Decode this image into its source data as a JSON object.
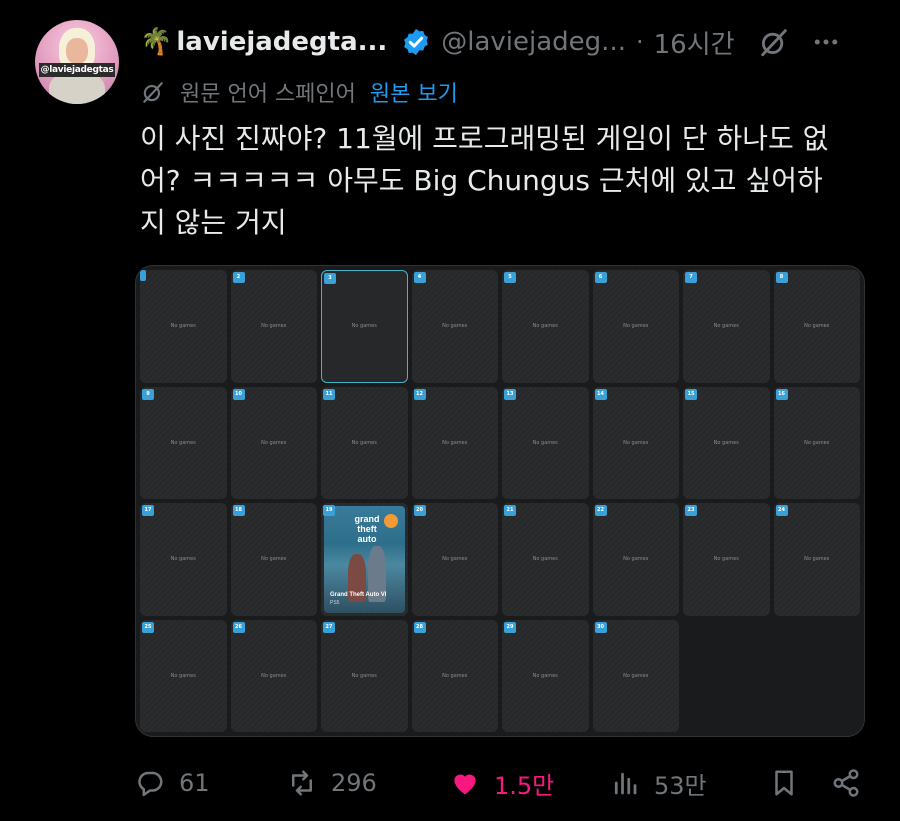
{
  "avatar": {
    "tag_text": "@laviejadegtas"
  },
  "header": {
    "emoji": "🌴",
    "display_name": "laviejadegta...",
    "handle": "@laviejadeg...",
    "separator": "·",
    "time": "16시간"
  },
  "translation": {
    "notice": "원문 언어 스페인어",
    "show_original": "원본 보기"
  },
  "tweet": {
    "text": "이 사진 진짜야? 11월에 프로그래밍된 게임이 단 하나도 없\n어? ㅋㅋㅋㅋㅋ 아무도 Big Chungus 근처에 있고 싶어하\n지 않는 거지"
  },
  "calendar": {
    "empty_label": "No games",
    "days": [
      {
        "day": "",
        "type": "empty_partial"
      },
      {
        "day": "2",
        "type": "no_games"
      },
      {
        "day": "3",
        "type": "highlight"
      },
      {
        "day": "4",
        "type": "no_games"
      },
      {
        "day": "5",
        "type": "no_games"
      },
      {
        "day": "6",
        "type": "no_games"
      },
      {
        "day": "7",
        "type": "no_games"
      },
      {
        "day": "8",
        "type": "no_games"
      },
      {
        "day": "9",
        "type": "no_games"
      },
      {
        "day": "10",
        "type": "no_games"
      },
      {
        "day": "11",
        "type": "no_games"
      },
      {
        "day": "12",
        "type": "no_games"
      },
      {
        "day": "13",
        "type": "no_games"
      },
      {
        "day": "14",
        "type": "no_games"
      },
      {
        "day": "15",
        "type": "no_games"
      },
      {
        "day": "16",
        "type": "no_games"
      },
      {
        "day": "17",
        "type": "no_games"
      },
      {
        "day": "18",
        "type": "no_games"
      },
      {
        "day": "19",
        "type": "game"
      },
      {
        "day": "20",
        "type": "no_games"
      },
      {
        "day": "21",
        "type": "no_games"
      },
      {
        "day": "22",
        "type": "no_games"
      },
      {
        "day": "23",
        "type": "no_games"
      },
      {
        "day": "24",
        "type": "no_games"
      },
      {
        "day": "25",
        "type": "no_games"
      },
      {
        "day": "26",
        "type": "no_games"
      },
      {
        "day": "27",
        "type": "no_games"
      },
      {
        "day": "28",
        "type": "no_games"
      },
      {
        "day": "29",
        "type": "no_games"
      },
      {
        "day": "30",
        "type": "no_games"
      },
      {
        "day": "",
        "type": "blank"
      },
      {
        "day": "",
        "type": "blank"
      }
    ],
    "game": {
      "logo": "grand\ntheft\nauto",
      "title": "Grand Theft Auto VI",
      "platform": "PS5"
    }
  },
  "actions": {
    "replies": "61",
    "reposts": "296",
    "likes": "1.5만",
    "views": "53만"
  },
  "colors": {
    "background": "#000000",
    "text": "#e7e9ea",
    "muted": "#71767b",
    "link": "#1d9bf0",
    "like": "#f91880",
    "badge": "#3aa0d8"
  }
}
